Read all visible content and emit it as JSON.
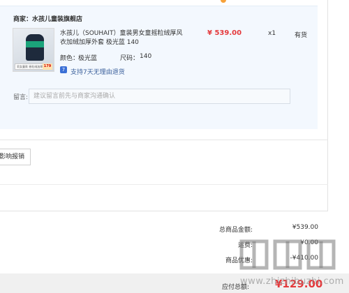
{
  "shop": {
    "label": "商家：水孩儿童装旗舰店"
  },
  "product": {
    "title": "水孩儿（SOUHAIT）童装男女童摇粒绒厚风衣加绒加厚外套 极光蓝 140",
    "color_label": "颜色：",
    "color_value": "极光蓝",
    "size_label": "尺码：",
    "size_value": "140",
    "price": "¥ 539.00",
    "quantity": "x1",
    "stock": "有货",
    "return_badge": "7",
    "return_policy": "支持7天无理由退货",
    "image_tag": "男女童款 摇粒绒加厚",
    "image_price": "179"
  },
  "message": {
    "label": "留言:",
    "placeholder": "建议留言前先与商家沟通确认"
  },
  "invoice": {
    "button_label": "影响报销"
  },
  "summary": {
    "goods_total_label": "总商品金额:",
    "goods_total_value": "¥539.00",
    "shipping_label": "运费:",
    "shipping_value": "¥0.00",
    "discount_label": "商品优惠:",
    "discount_value": "-¥410.00"
  },
  "payment": {
    "label": "应付总额:",
    "amount": "¥129.00"
  },
  "watermark": {
    "text": "www.zhizhibuzhi.com"
  },
  "colors": {
    "accent_red": "#e4393c",
    "box_bg": "#f3f8fe",
    "link_blue": "#3a5f9b"
  }
}
